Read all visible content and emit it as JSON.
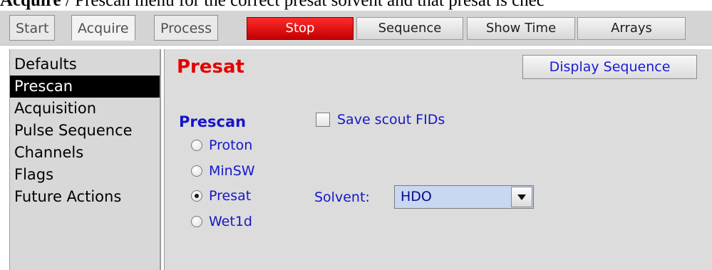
{
  "doc_text": {
    "bold": "Acquire",
    "rest": " / Prescan menu for the correct presat solvent and that presat is chec"
  },
  "tabs": [
    "Start",
    "Acquire",
    "Process"
  ],
  "toolbar": {
    "stop_label": "Stop",
    "sequence_label": "Sequence",
    "show_time_label": "Show Time",
    "arrays_label": "Arrays"
  },
  "sidebar": {
    "items": [
      "Defaults",
      "Prescan",
      "Acquisition",
      "Pulse Sequence",
      "Channels",
      "Flags",
      "Future Actions"
    ],
    "selected": "Prescan"
  },
  "main": {
    "title": "Presat",
    "display_sequence_label": "Display Sequence",
    "prescan_label": "Prescan",
    "radios": [
      "Proton",
      "MinSW",
      "Presat",
      "Wet1d"
    ],
    "selected_radio": "Presat",
    "save_scout_label": "Save scout FIDs",
    "solvent_label": "Solvent:",
    "solvent_value": "HDO"
  },
  "colors": {
    "stop_red": "#e00000",
    "title_red": "#e50000",
    "label_blue": "#1616c8",
    "selected_nav_bg": "#000000"
  }
}
